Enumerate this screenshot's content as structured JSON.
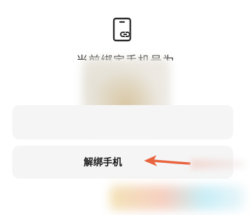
{
  "icon": "phone-link-icon",
  "bound_text": "当前绑定手机号为",
  "unbind_button_label": "解绑手机",
  "colors": {
    "icon_stroke": "#2b2b2b",
    "card_bg": "#f5f5f5",
    "arrow": "#e8643f"
  }
}
